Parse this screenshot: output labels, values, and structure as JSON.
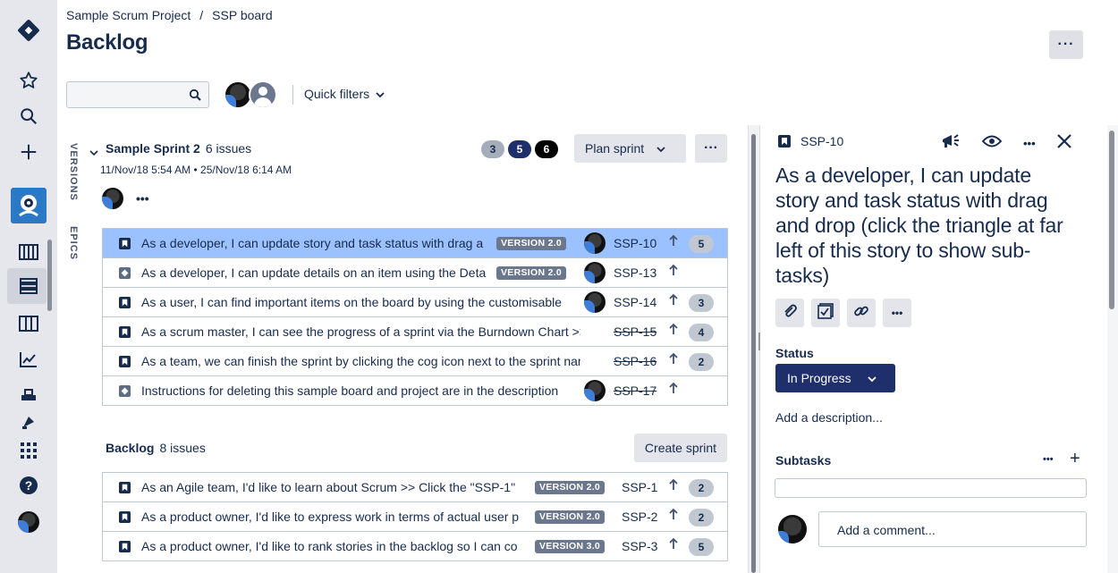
{
  "breadcrumb": {
    "project": "Sample Scrum Project",
    "separator": "/",
    "board": "SSP board"
  },
  "page": {
    "title": "Backlog",
    "more_label": "···"
  },
  "search": {
    "placeholder": ""
  },
  "filters": {
    "quick_filters_label": "Quick filters"
  },
  "side_tabs": {
    "versions": "VERSIONS",
    "epics": "EPICS"
  },
  "sprint": {
    "name": "Sample Sprint 2",
    "issue_count": "6 issues",
    "dates": "11/Nov/18 5:54 AM • 25/Nov/18 6:14 AM",
    "counts": [
      {
        "value": "3",
        "bg": "#a5adba",
        "fg": "#172b4d"
      },
      {
        "value": "5",
        "bg": "#1f2f6b",
        "fg": "#ffffff"
      },
      {
        "value": "6",
        "bg": "#000000",
        "fg": "#ffffff"
      }
    ],
    "plan_label": "Plan sprint",
    "more_label": "···",
    "meta_more": "•••",
    "issues": [
      {
        "type": "story",
        "summary": "As a developer, I can update story and task status with drag a",
        "version": "VERSION 2.0",
        "key": "SSP-10",
        "done": false,
        "estimate": "5",
        "selected": true,
        "assigned": true
      },
      {
        "type": "task",
        "summary": "As a developer, I can update details on an item using the Deta",
        "version": "VERSION 2.0",
        "key": "SSP-13",
        "done": false,
        "estimate": "",
        "selected": false,
        "assigned": true
      },
      {
        "type": "story",
        "summary": "As a user, I can find important items on the board by using the customisable",
        "version": "",
        "key": "SSP-14",
        "done": false,
        "estimate": "3",
        "selected": false,
        "assigned": true
      },
      {
        "type": "story",
        "summary": "As a scrum master, I can see the progress of a sprint via the Burndown Chart >> C",
        "version": "",
        "key": "SSP-15",
        "done": true,
        "estimate": "4",
        "selected": false,
        "assigned": false
      },
      {
        "type": "story",
        "summary": "As a team, we can finish the sprint by clicking the cog icon next to the sprint name",
        "version": "",
        "key": "SSP-16",
        "done": true,
        "estimate": "2",
        "selected": false,
        "assigned": false
      },
      {
        "type": "task",
        "summary": "Instructions for deleting this sample board and project are in the description",
        "version": "",
        "key": "SSP-17",
        "done": true,
        "estimate": "",
        "selected": false,
        "assigned": true
      }
    ]
  },
  "backlog": {
    "title": "Backlog",
    "issue_count": "8 issues",
    "create_label": "Create sprint",
    "issues": [
      {
        "type": "story",
        "summary": "As an Agile team, I'd like to learn about Scrum >> Click the \"SSP-1\"",
        "version": "VERSION 2.0",
        "key": "SSP-1",
        "estimate": "2"
      },
      {
        "type": "story",
        "summary": "As a product owner, I'd like to express work in terms of actual user p",
        "version": "VERSION 2.0",
        "key": "SSP-2",
        "estimate": "2"
      },
      {
        "type": "story",
        "summary": "As a product owner, I'd like to rank stories in the backlog so I can co",
        "version": "VERSION 3.0",
        "key": "SSP-3",
        "estimate": "5"
      }
    ]
  },
  "detail": {
    "key": "SSP-10",
    "title": "As a developer, I can update story and task status with drag and drop (click the triangle at far left of this story to show sub-tasks)",
    "status_label": "Status",
    "status_value": "In Progress",
    "add_description": "Add a description...",
    "subtasks_label": "Subtasks",
    "subtasks_more": "•••",
    "subtasks_add": "+",
    "comment_placeholder": "Add a comment...",
    "more_label": "•••"
  },
  "colors": {
    "selected_row": "#9bc1ff",
    "status_bg": "#1f2f6b",
    "nav_bg": "#e6e7ed"
  }
}
